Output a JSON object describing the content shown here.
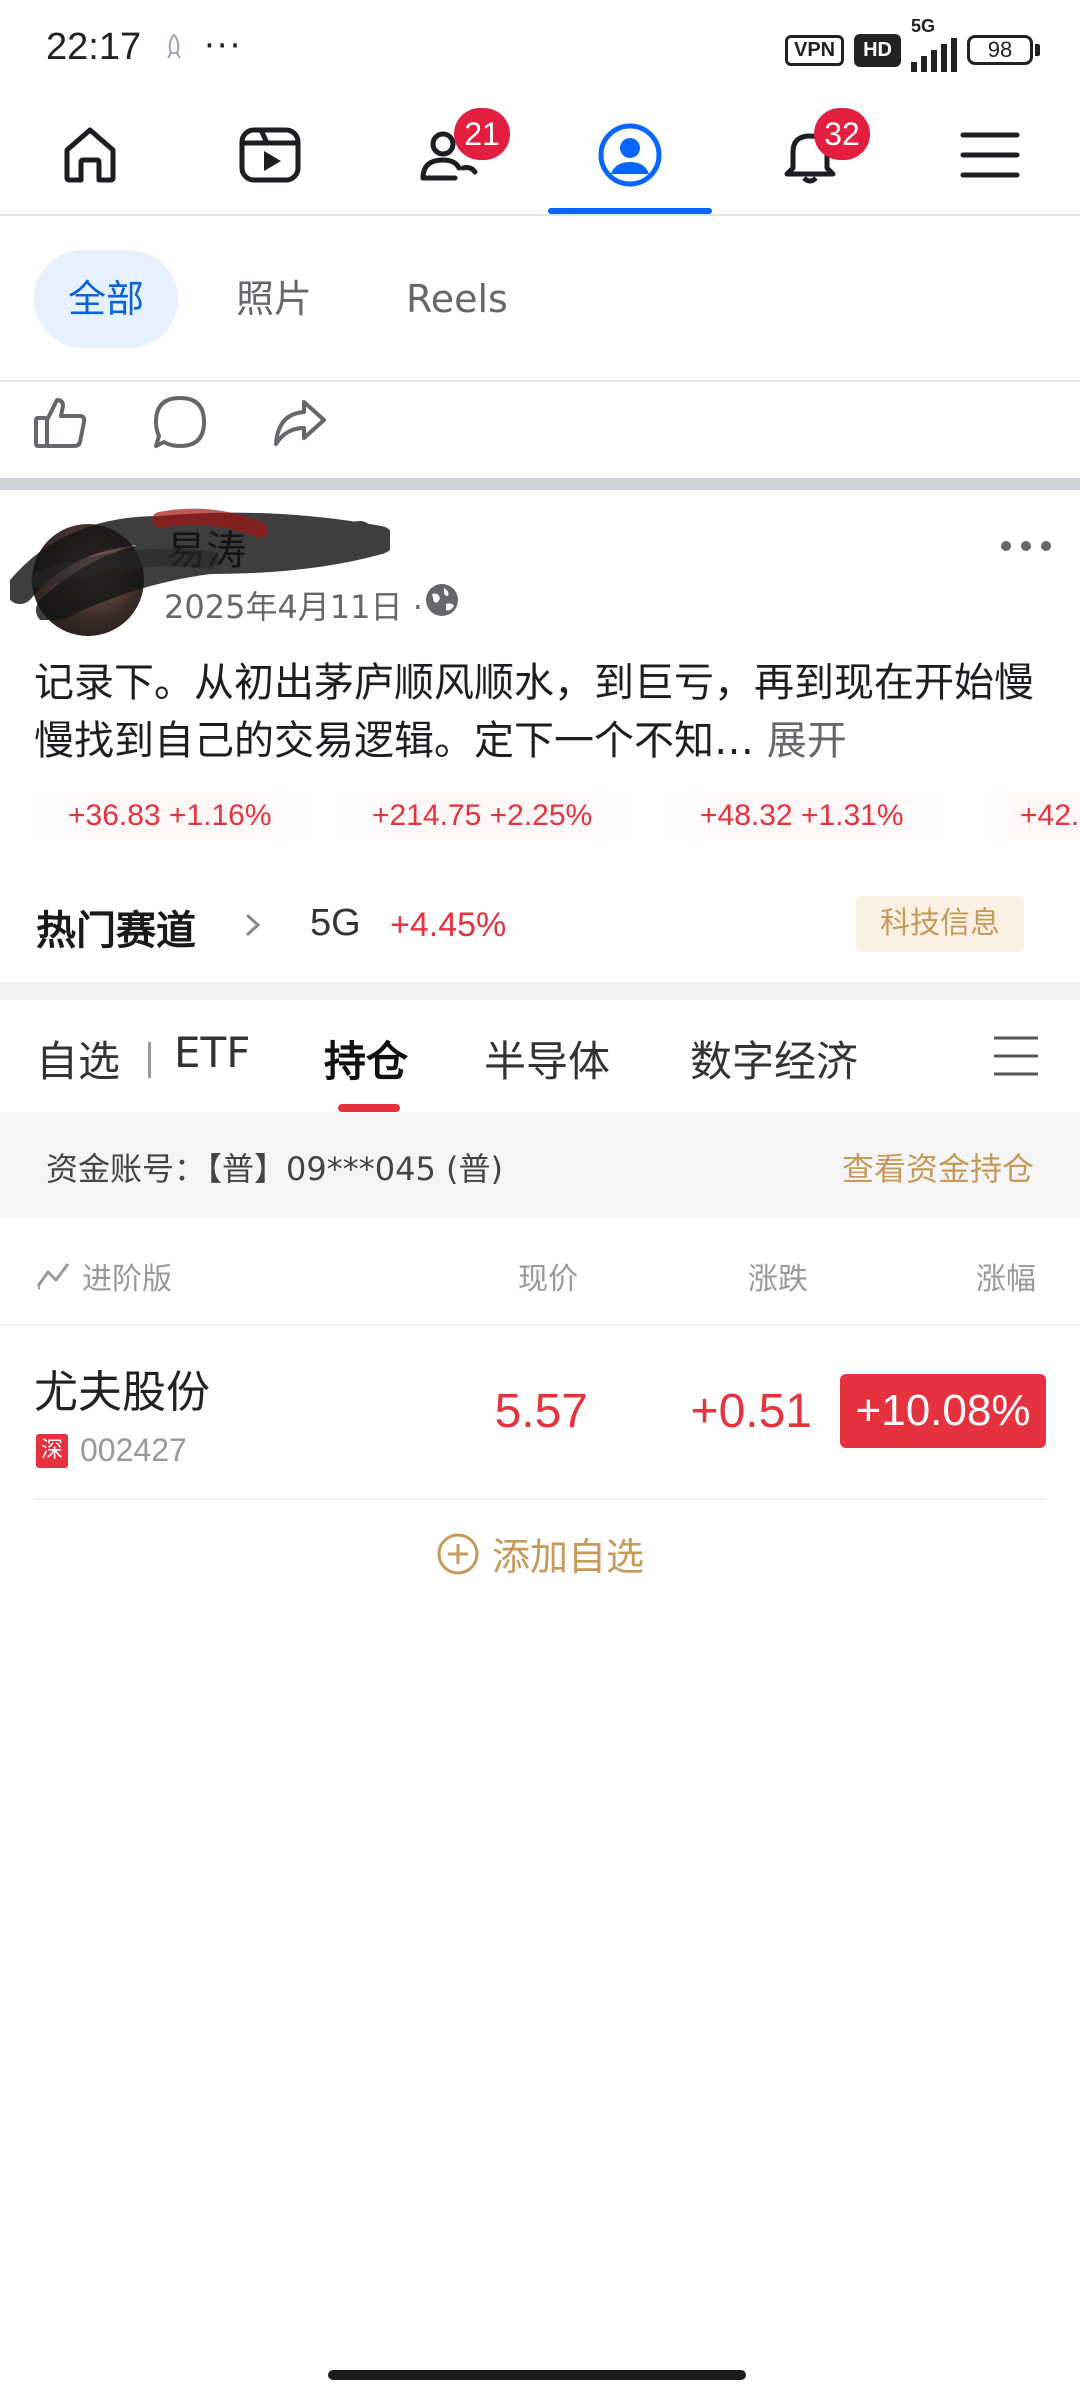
{
  "status_bar": {
    "time": "22:17",
    "dots": "···",
    "vpn": "VPN",
    "hd": "HD",
    "network": "5G",
    "battery": "98"
  },
  "top_nav": {
    "active_tab": "profile",
    "accent_color": "#0866ff",
    "friends_badge": "21",
    "notifications_badge": "32"
  },
  "filter_tabs": [
    "全部",
    "照片",
    "Reels"
  ],
  "post": {
    "author": "易涛",
    "date": "2025年4月11日",
    "date_separator": "·",
    "text": "记录下。从初出茅庐顺风顺水，到巨亏，再到现在开始慢慢找到自己的交易逻辑。定下一个不知…",
    "see_more": "展开"
  },
  "stock_app": {
    "index_strip": [
      "+36.83 +1.16%",
      "+214.75 +2.25%",
      "+48.32 +1.31%",
      "+42."
    ],
    "hot_track": {
      "title": "热门赛道",
      "name": "5G",
      "change": "+4.45%",
      "tag": "科技信息"
    },
    "tabs": [
      "自选",
      "ETF",
      "持仓",
      "半导体",
      "数字经济"
    ],
    "active_tab": "持仓",
    "account": {
      "label": "资金账号：【普】09***045 (普)",
      "link": "查看资金持仓"
    },
    "list_header": {
      "pro": "进阶版",
      "price": "现价",
      "change": "涨跌",
      "pct": "涨幅"
    },
    "holdings": [
      {
        "name": "尤夫股份",
        "market": "深",
        "code": "002427",
        "price": "5.57",
        "change": "+0.51",
        "pct": "+10.08%"
      }
    ],
    "add_watch": "添加自选",
    "up_color": "#e5323e",
    "gold_color": "#c69a5a"
  }
}
